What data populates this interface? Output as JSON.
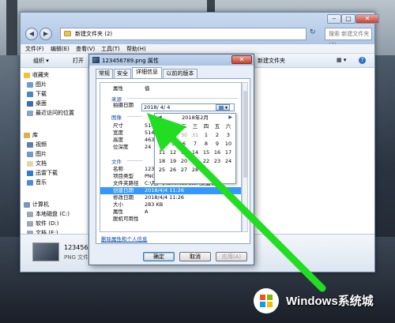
{
  "explorer": {
    "address": "新建文件夹 (2)",
    "search_placeholder": "搜索 新建文件夹 (2)",
    "menus": [
      "文件(F)",
      "编辑(E)",
      "查看(V)",
      "工具(T)",
      "帮助(H)"
    ],
    "toolbar": {
      "organize": "组织 ▾",
      "open": "打开",
      "new_folder": "新建文件夹"
    },
    "nav": {
      "favorites": "收藏夹",
      "favorites_items": [
        "图片",
        "下载",
        "桌面",
        "最近访问的位置"
      ],
      "libraries": "库",
      "library_items": [
        "视频",
        "图片",
        "文档",
        "迅雷下载",
        "音乐"
      ],
      "computer": "计算机",
      "drives": [
        "本地磁盘 (C:)",
        "软件 (D:)",
        "文档 (E:)"
      ]
    },
    "details": {
      "filename": "123456789.png",
      "type": "PNG 文件"
    }
  },
  "dialog": {
    "title": "123456789.png 属性",
    "tabs": [
      "常规",
      "安全",
      "详细信息",
      "以前的版本"
    ],
    "headers": {
      "prop": "属性",
      "val": "值"
    },
    "groups": {
      "source": "来源",
      "image": "图像",
      "file": "文件"
    },
    "rows_top": [
      {
        "k": "拍摄日期",
        "v": "2018/ 4/ 4"
      }
    ],
    "rows_image": [
      {
        "k": "尺寸",
        "v": "514 x"
      },
      {
        "k": "宽度",
        "v": "514 像"
      },
      {
        "k": "高度",
        "v": "463 像"
      },
      {
        "k": "位深度",
        "v": "24"
      }
    ],
    "rows_file": [
      {
        "k": "名称",
        "v": "12345"
      },
      {
        "k": "项目类型",
        "v": "PNG 文"
      },
      {
        "k": "文件夹路径",
        "v": "C:\\用户\\Administrator\\桌面\\新"
      },
      {
        "k": "创建日期",
        "v": "2018/4/4 11:26"
      },
      {
        "k": "修改日期",
        "v": "2018/4/4 11:26"
      },
      {
        "k": "大小",
        "v": "283 KB"
      },
      {
        "k": "属性",
        "v": "A"
      },
      {
        "k": "脱机可用性",
        "v": ""
      }
    ],
    "date_value": "2018/ 4/ 4",
    "link": "删除属性和个人信息",
    "buttons": {
      "ok": "确定",
      "cancel": "取消",
      "apply": "应用(A)"
    }
  },
  "calendar": {
    "month": "2018年2月",
    "weekdays": [
      "日",
      "一",
      "二",
      "三",
      "四",
      "五",
      "六"
    ],
    "weeks": [
      [
        "28",
        "29",
        "30",
        "31",
        "1",
        "2",
        "3"
      ],
      [
        "4",
        "5",
        "6",
        "7",
        "8",
        "9",
        "10"
      ],
      [
        "11",
        "12",
        "13",
        "14",
        "15",
        "16",
        "17"
      ],
      [
        "18",
        "19",
        "20",
        "21",
        "22",
        "23",
        "24"
      ],
      [
        "25",
        "26",
        "27",
        "28",
        "",
        "",
        ""
      ]
    ]
  },
  "watermark": {
    "text": "Windows系统城"
  },
  "colors": {
    "arrow": "#22dd22",
    "selection": "#3399ff",
    "accent": "#1e4fa3"
  }
}
